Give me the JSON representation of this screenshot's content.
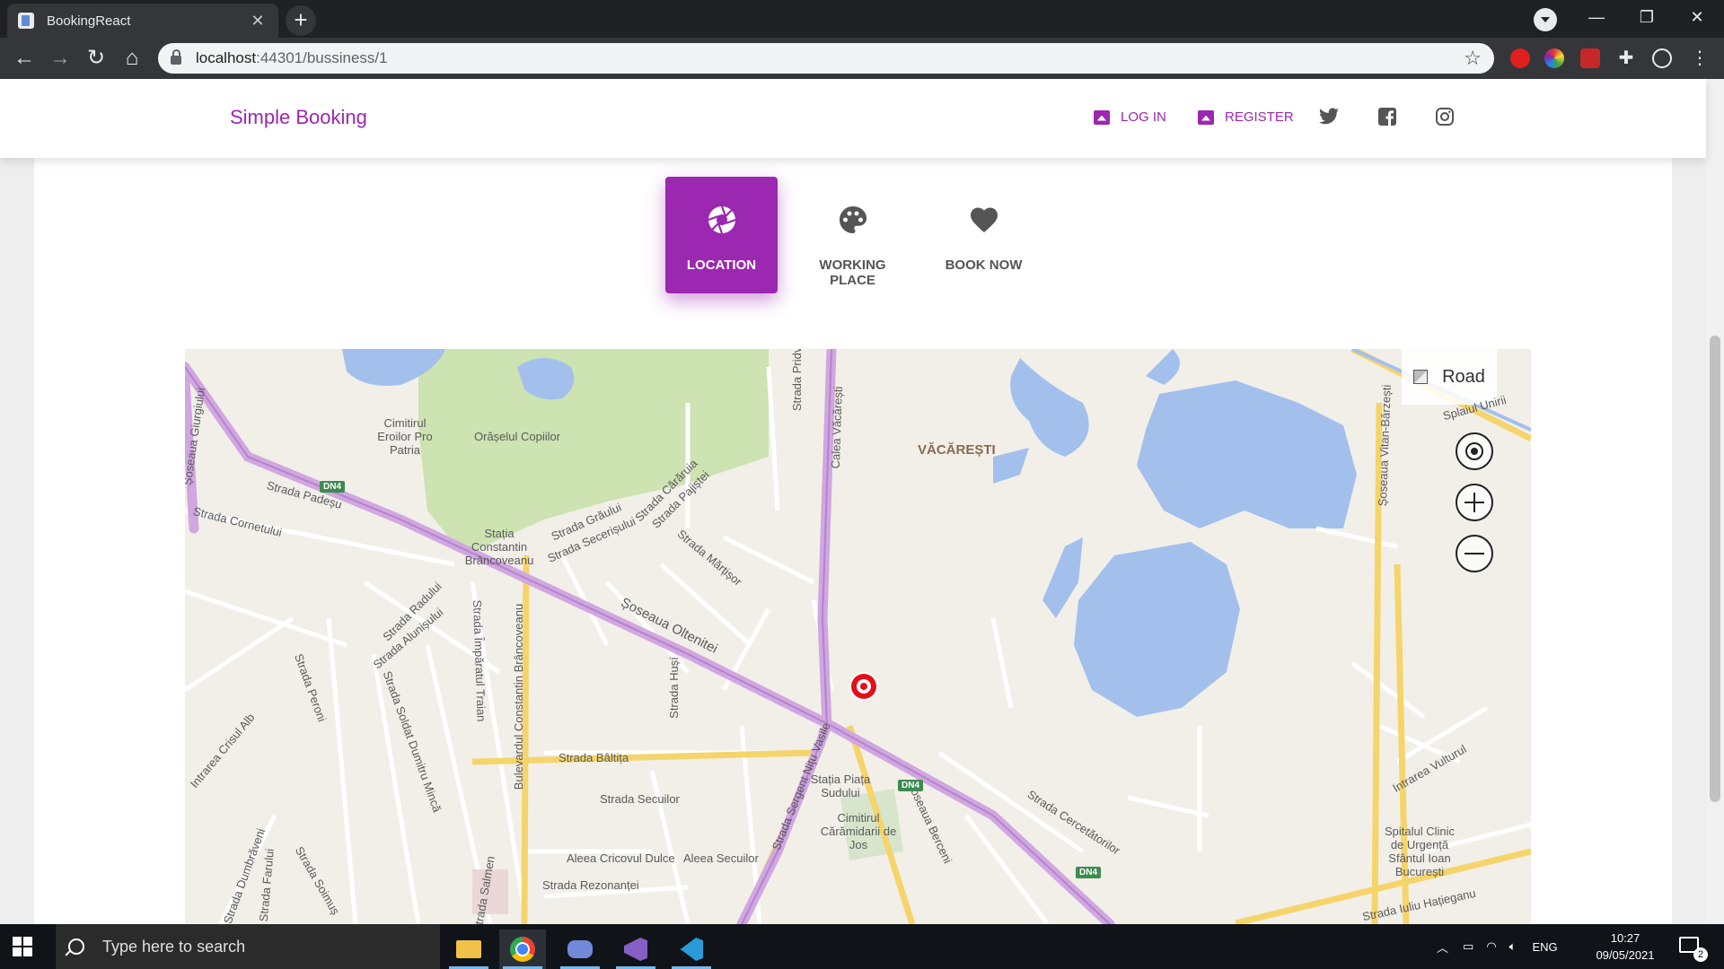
{
  "browser": {
    "tab_title": "BookingReact",
    "tab_close": "✕",
    "new_tab": "+",
    "url_host": "localhost",
    "url_path": ":44301/bussiness/1",
    "window_controls": [
      "—",
      "❐",
      "✕"
    ]
  },
  "header": {
    "brand": "Simple Booking",
    "nav": [
      {
        "label": "LOG IN",
        "icon": "login-icon"
      },
      {
        "label": "REGISTER",
        "icon": "register-icon"
      }
    ],
    "social": [
      "twitter-icon",
      "facebook-icon",
      "instagram-icon"
    ],
    "accent_color": "#9c27b0"
  },
  "tabs": [
    {
      "label": "LOCATION",
      "icon": "aperture-icon",
      "active": true
    },
    {
      "label": "WORKING PLACE",
      "icon": "palette-icon",
      "active": false
    },
    {
      "label": "BOOK NOW",
      "icon": "heart-icon",
      "active": false
    }
  ],
  "map": {
    "layer_button": "Road",
    "district": "VĂCĂREȘTI",
    "labels": [
      "Cimitirul Eroilor Pro Patria",
      "Orășelul Copiilor",
      "Strada Padeșu",
      "Strada Cornetului",
      "Stația Constantin Brâncoveanu",
      "Strada Grăului",
      "Strada Secerișului",
      "Strada Cărăruia",
      "Strada Pajiștei",
      "Strada Mărțișor",
      "Strada Pridvorului",
      "Strada Radului",
      "Strada Alunișului",
      "Strada Peroni",
      "Strada Soldat Dumitru Mincă",
      "Strada Împăratul Traian",
      "Bulevardul Constantin Brâncoveanu",
      "Strada Bâltița",
      "Strada Secuilor",
      "Strada Hușí",
      "Aleea Cricovul Dulce",
      "Aleea Secuilor",
      "Strada Rezonanței",
      "Stația Piața Sudului",
      "Cimitirul Cărămidarii de Jos",
      "Strada Sergent Nițu Vasile",
      "Șoseaua Berceni",
      "Strada Cercetătorilor",
      "Spitalul Clinic de Urgență Sfântul Ioan București",
      "Șoseaua Vitan-Bârzești",
      "Intrarea Vulturul",
      "Strada Iuliu Hațieganu",
      "Intrarea Crisul Alb",
      "Strada Dumbrăveni",
      "Strada Farului",
      "Strada Soimuș",
      "Strada Salmen",
      "Calea Văcărești",
      "Șoseaua Oltenitei",
      "Șoseaua Giurgiului",
      "Splaiul Unirii"
    ],
    "road_badge": "DN4",
    "marker_color": "#e3101a"
  },
  "taskbar": {
    "search_placeholder": "Type here to search",
    "apps": [
      "file-explorer-icon",
      "chrome-icon",
      "discord-icon",
      "visual-studio-icon",
      "vscode-icon"
    ],
    "lang": "ENG",
    "time": "10:27",
    "date": "09/05/2021",
    "notifications": "2"
  }
}
